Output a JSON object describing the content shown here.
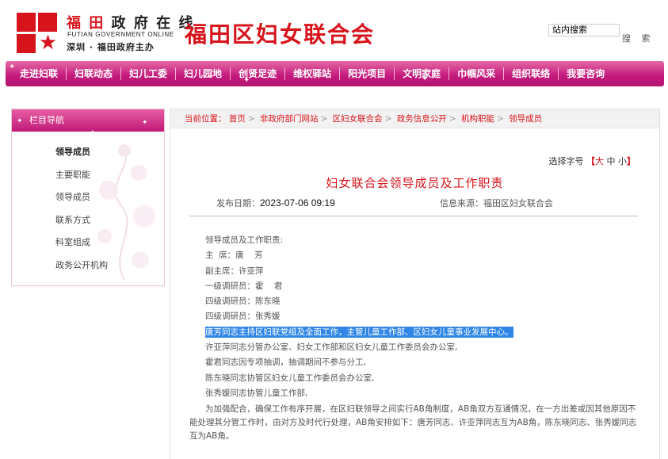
{
  "header": {
    "logo_cn_red": "福 田",
    "logo_cn_rest": " 政 府 在 线",
    "logo_en": "FUTIAN GOVERNMENT ONLINE",
    "logo_sub": "深圳 · 福田政府主办",
    "site_title": "福田区妇女联合会",
    "search_placeholder": "站内搜索",
    "search_button": "搜 索",
    "brand_color": "#d7141c"
  },
  "nav": {
    "items": [
      "走进妇联",
      "妇联动态",
      "妇儿工委",
      "妇儿园地",
      "创贤足迹",
      "维权驿站",
      "阳光项目",
      "文明家庭",
      "巾帼风采",
      "组织联络",
      "我要咨询"
    ],
    "color": "#c3187c"
  },
  "sidebar": {
    "title": "栏目导航",
    "items": [
      "领导成员",
      "主要职能",
      "领导成员",
      "联系方式",
      "科室组成",
      "政务公开机构"
    ],
    "active_index": 0
  },
  "breadcrumb": {
    "prefix": "当前位置：",
    "items": [
      "首页",
      "非政府部门网站",
      "区妇女联合会",
      "政务信息公开",
      "机构职能",
      "领导成员"
    ],
    "separator": ">"
  },
  "font_size": {
    "label": "选择字号",
    "open": "【",
    "big": "大",
    "medium": "中",
    "small": "小",
    "close": "】"
  },
  "article": {
    "title": "妇女联合会领导成员及工作职责",
    "date_label": "发布日期：",
    "date": "2023-07-06 09:19",
    "source_label": "信息来源：",
    "source": "福田区妇女联合会",
    "lines": [
      "领导成员及工作职责:",
      "主  席：唐    芳",
      "副主席：许亚萍",
      "一级调研员：霍    君",
      "四级调研员：陈东晓",
      "四级调研员：张秀媛"
    ],
    "highlighted_line": "唐芳同志主持区妇联党组及全面工作，主管儿童工作部、区妇女儿童事业发展中心。",
    "lines_after": [
      "许亚萍同志分管办公室、妇女工作部和区妇女儿童工作委员会办公室,",
      "霍君同志因专项抽调，抽调期间不参与分工,",
      "陈东晓同志协管区妇女儿童工作委员会办公室,",
      "张秀媛同志协管儿童工作部,"
    ],
    "final_paragraph": "为加强配合，确保工作有序开展，在区妇联领导之间实行AB角制度，AB角双方互通情况，在一方出差或因其他原因不能处理其分管工作时，由对方及时代行处理，AB角安排如下：唐芳同志、许亚萍同志互为AB角，陈东晓同志、张秀媛同志互为AB角。"
  }
}
